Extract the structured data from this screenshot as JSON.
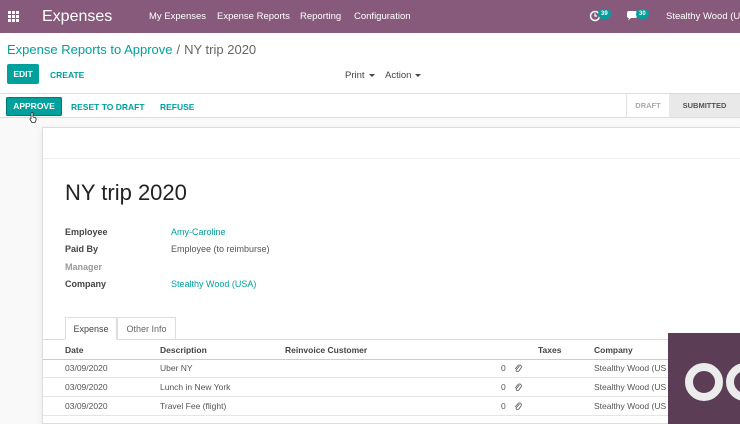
{
  "navbar": {
    "app_name": "Expenses",
    "menu": [
      "My Expenses",
      "Expense Reports",
      "Reporting",
      "Configuration"
    ],
    "activity_count": "39",
    "messages_count": "30",
    "company": "Stealthy Wood (US"
  },
  "control_panel": {
    "breadcrumb_parent": "Expense Reports to Approve",
    "breadcrumb_separator": "/",
    "breadcrumb_current": "NY trip 2020",
    "edit_label": "EDIT",
    "create_label": "CREATE",
    "print_label": "Print",
    "action_label": "Action"
  },
  "statusbar": {
    "approve_label": "APPROVE",
    "reset_label": "RESET TO DRAFT",
    "refuse_label": "REFUSE",
    "stages": [
      "DRAFT",
      "SUBMITTED"
    ],
    "active_stage": "SUBMITTED"
  },
  "form": {
    "title": "NY trip 2020",
    "fields": [
      {
        "label": "Employee",
        "value": "Amy-Caroline"
      },
      {
        "label": "Paid By",
        "value": "Employee (to reimburse)"
      },
      {
        "label": "Manager",
        "value": ""
      },
      {
        "label": "Company",
        "value": "Stealthy Wood (USA)"
      }
    ],
    "tabs": [
      "Expense",
      "Other Info"
    ],
    "active_tab": "Expense"
  },
  "expense_table": {
    "headers": [
      "Date",
      "Description",
      "Reinvoice Customer",
      "Taxes",
      "Company"
    ],
    "rows": [
      {
        "date": "03/09/2020",
        "description": "Uber NY",
        "attachments": "0",
        "company": "Stealthy Wood (US"
      },
      {
        "date": "03/09/2020",
        "description": "Lunch in New York",
        "attachments": "0",
        "company": "Stealthy Wood (US"
      },
      {
        "date": "03/09/2020",
        "description": "Travel Fee (flight)",
        "attachments": "0",
        "company": "Stealthy Wood (US"
      }
    ]
  },
  "colors": {
    "navbar": "#875a7b",
    "primary": "#00a09d",
    "overlay": "#5b3e55"
  }
}
